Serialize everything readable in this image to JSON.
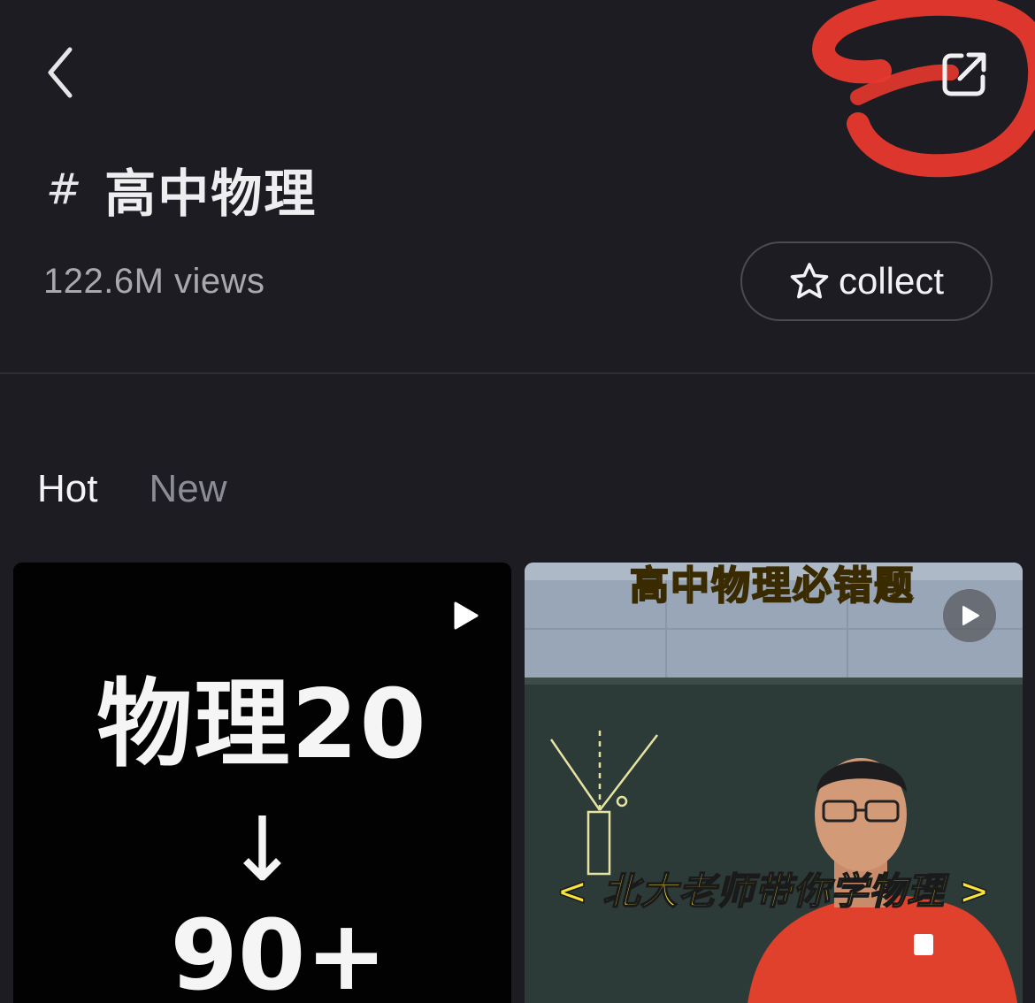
{
  "header": {
    "back_icon": "chevron-left-icon",
    "share_icon": "share-external-icon",
    "annotation_color": "#e8392e"
  },
  "topic": {
    "hash": "#",
    "title": "高中物理",
    "views": "122.6M views"
  },
  "collect": {
    "label": "collect",
    "icon": "star-outline-icon"
  },
  "tabs": [
    {
      "label": "Hot",
      "active": true
    },
    {
      "label": "New",
      "active": false
    }
  ],
  "videos": [
    {
      "cover_line1": "物理20",
      "cover_arrow": "↓",
      "cover_line2": "90+",
      "play_icon": "play-icon"
    },
    {
      "cover_top_text": "高中物理必错题",
      "cover_caption": "< 北大老师带你学物理 >",
      "play_icon": "play-circle-icon"
    }
  ],
  "colors": {
    "background": "#1c1c22",
    "text_primary": "#f4f4f6",
    "text_secondary": "#a8a8ae",
    "tab_inactive": "#8c8c94",
    "caption_yellow": "#f7e33a"
  }
}
